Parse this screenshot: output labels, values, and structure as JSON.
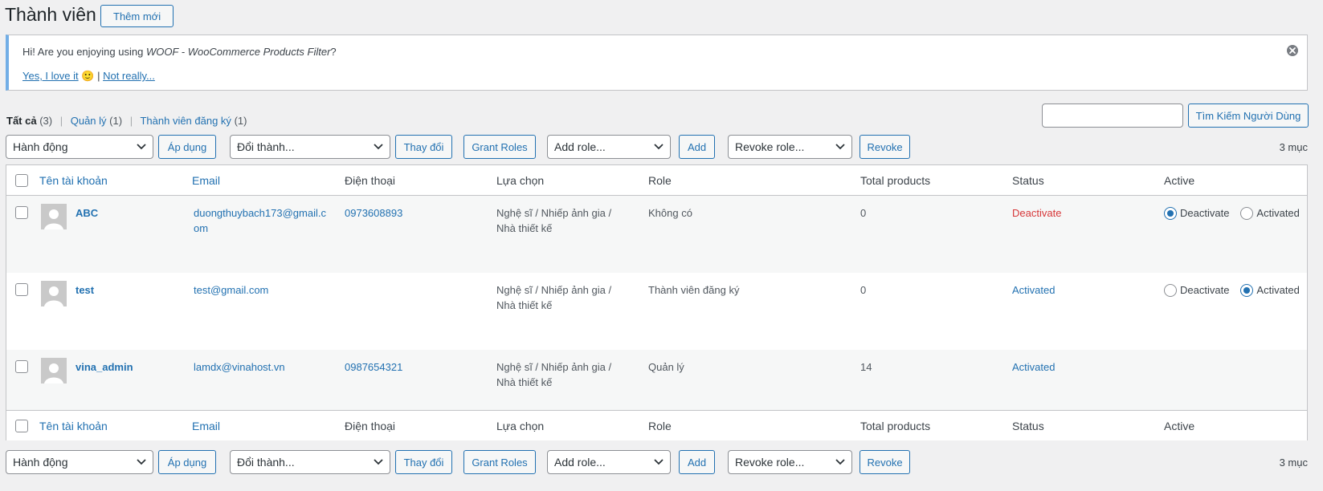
{
  "header": {
    "title": "Thành viên",
    "add_new_label": "Thêm mới"
  },
  "notice": {
    "text_prefix": "Hi! Are you enjoying using ",
    "plugin_name": "WOOF - WooCommerce Products Filter",
    "text_suffix": "?",
    "yes_label": "Yes, I love it",
    "yes_emoji": "🙂",
    "separator": "|",
    "no_label": "Not really...",
    "close_icon": "close-circle-icon"
  },
  "views": [
    {
      "label": "Tất cả",
      "count": "(3)"
    },
    {
      "label": "Quản lý",
      "count": "(1)"
    },
    {
      "label": "Thành viên đăng ký",
      "count": "(1)"
    }
  ],
  "search": {
    "button_label": "Tìm Kiếm Người Dùng",
    "value": ""
  },
  "tablenav": {
    "bulk_action": "Hành động",
    "apply_label": "Áp dụng",
    "change_role": "Đổi thành...",
    "change_label": "Thay đổi",
    "grant_roles_label": "Grant Roles",
    "add_role": "Add role...",
    "add_label": "Add",
    "revoke_role": "Revoke role...",
    "revoke_label": "Revoke",
    "count": "3 mục"
  },
  "columns": {
    "username": "Tên tài khoản",
    "email": "Email",
    "phone": "Điện thoại",
    "choice": "Lựa chọn",
    "role": "Role",
    "total_products": "Total products",
    "status": "Status",
    "active": "Active"
  },
  "radio_labels": {
    "deactivate": "Deactivate",
    "activated": "Activated"
  },
  "users": [
    {
      "username": "ABC",
      "email_line1": "duongthuybach173@gmail.c",
      "email_line2": "om",
      "phone": "0973608893",
      "choice_line1": "Nghệ sĩ / Nhiếp ảnh gia /",
      "choice_line2": "Nhà thiết kế",
      "role": "Không có",
      "total_products": "0",
      "status": "Deactivate",
      "status_color": "#d63638",
      "active": "deactivate"
    },
    {
      "username": "test",
      "email_line1": "test@gmail.com",
      "email_line2": "",
      "phone": "",
      "choice_line1": "Nghệ sĩ / Nhiếp ảnh gia /",
      "choice_line2": "Nhà thiết kế",
      "role": "Thành viên đăng ký",
      "total_products": "0",
      "status": "Activated",
      "status_color": "#2271b1",
      "active": "activated"
    },
    {
      "username": "vina_admin",
      "email_line1": "lamdx@vinahost.vn",
      "email_line2": "",
      "phone": "0987654321",
      "choice_line1": "Nghệ sĩ / Nhiếp ảnh gia /",
      "choice_line2": "Nhà thiết kế",
      "role": "Quản lý",
      "total_products": "14",
      "status": "Activated",
      "status_color": "#2271b1",
      "active": "none"
    }
  ],
  "colors": {
    "accent": "#2271b1",
    "danger": "#d63638",
    "notice_border": "#72aee6"
  }
}
